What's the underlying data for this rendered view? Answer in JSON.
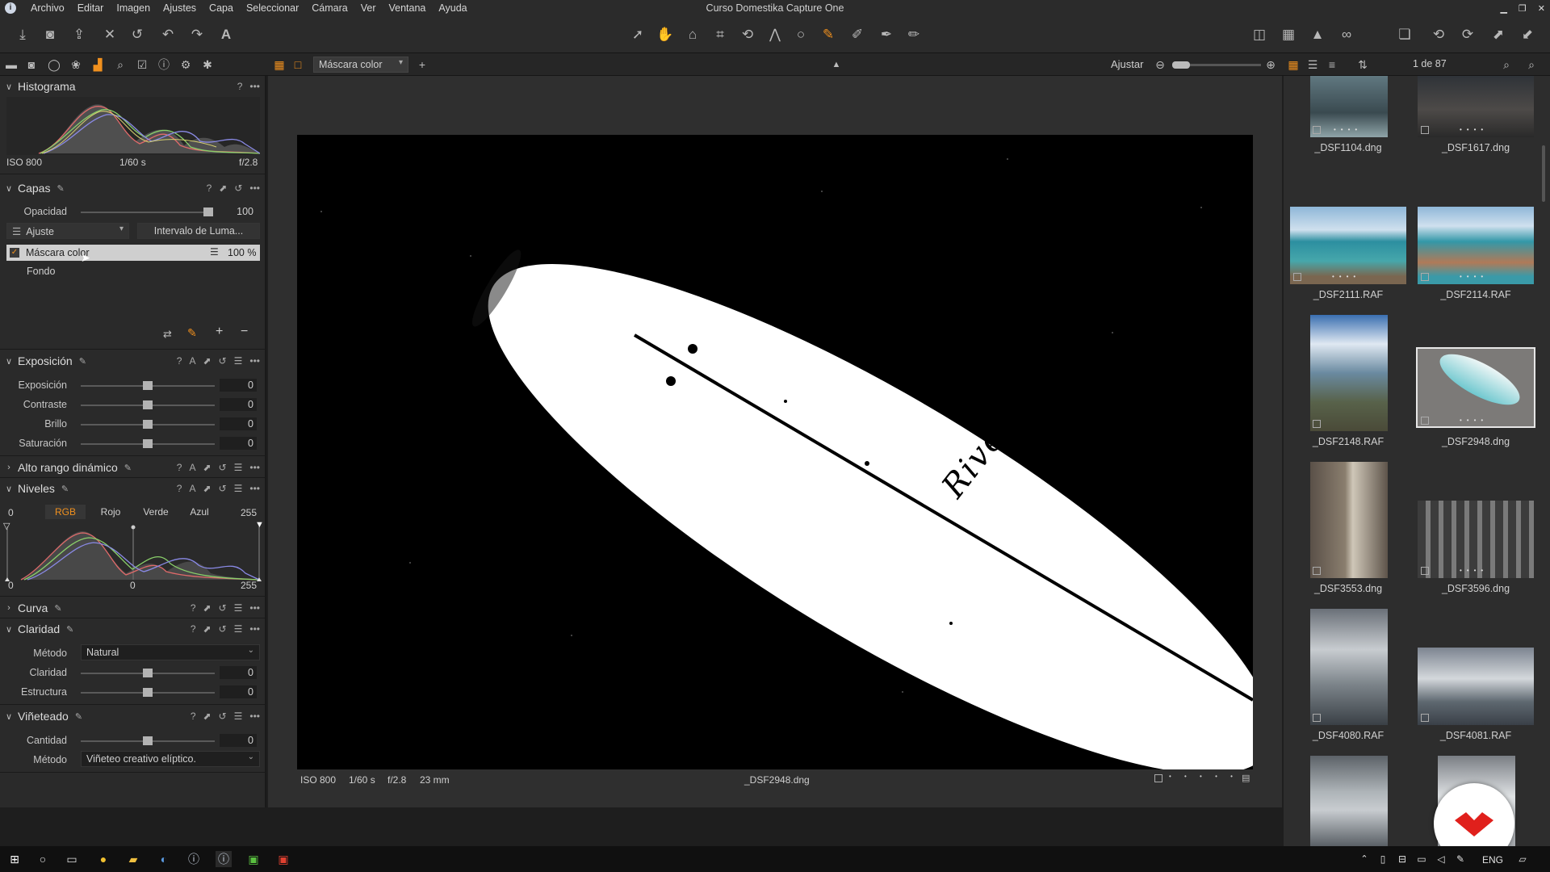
{
  "window": {
    "title": "Curso Domestika Capture One"
  },
  "menu": [
    "Archivo",
    "Editar",
    "Imagen",
    "Ajustes",
    "Capa",
    "Seleccionar",
    "Cámara",
    "Ver",
    "Ventana",
    "Ayuda"
  ],
  "viewer_toolbar": {
    "mode_dropdown": "Máscara color",
    "fit_label": "Ajustar"
  },
  "browser_header": {
    "counter": "1 de 87"
  },
  "histogram": {
    "title": "Histograma",
    "iso": "ISO 800",
    "shutter": "1/60 s",
    "aperture": "f/2.8"
  },
  "layers": {
    "title": "Capas",
    "opacity_label": "Opacidad",
    "opacity_value": "100",
    "adjust_dropdown": "Ajuste",
    "luma_button": "Intervalo de Luma...",
    "items": [
      {
        "name": "Máscara color",
        "opacity": "100 %",
        "checked": true
      },
      {
        "name": "Fondo"
      }
    ]
  },
  "exposure": {
    "title": "Exposición",
    "rows": [
      {
        "label": "Exposición",
        "value": "0"
      },
      {
        "label": "Contraste",
        "value": "0"
      },
      {
        "label": "Brillo",
        "value": "0"
      },
      {
        "label": "Saturación",
        "value": "0"
      }
    ]
  },
  "hdr": {
    "title": "Alto rango dinámico"
  },
  "levels": {
    "title": "Niveles",
    "in_low": "0",
    "in_high": "255",
    "channels": [
      "RGB",
      "Rojo",
      "Verde",
      "Azul"
    ],
    "out_low": "0",
    "out_mid": "0",
    "out_high": "255"
  },
  "curve": {
    "title": "Curva"
  },
  "clarity": {
    "title": "Claridad",
    "method_label": "Método",
    "method_value": "Natural",
    "rows": [
      {
        "label": "Claridad",
        "value": "0"
      },
      {
        "label": "Estructura",
        "value": "0"
      }
    ]
  },
  "vignetting": {
    "title": "Viñeteado",
    "amount_label": "Cantidad",
    "amount_value": "0",
    "method_label": "Método",
    "method_value": "Viñeteo creativo elíptico."
  },
  "image_meta": {
    "iso": "ISO 800",
    "shutter": "1/60 s",
    "aperture": "f/2.8",
    "focal": "23 mm",
    "filename": "_DSF2948.dng"
  },
  "photo": {
    "signature": "Rivera"
  },
  "thumbnails": [
    {
      "name": "_DSF1104.dng"
    },
    {
      "name": "_DSF1617.dng"
    },
    {
      "name": "_DSF2111.RAF"
    },
    {
      "name": "_DSF2114.RAF"
    },
    {
      "name": "_DSF2148.RAF"
    },
    {
      "name": "_DSF2948.dng",
      "selected": true
    },
    {
      "name": "_DSF3553.dng"
    },
    {
      "name": "_DSF3596.dng"
    },
    {
      "name": "_DSF4080.RAF"
    },
    {
      "name": "_DSF4081.RAF"
    },
    {
      "name": ""
    },
    {
      "name": ""
    }
  ],
  "taskbar": {
    "lang": "ENG"
  },
  "colors": {
    "accent": "#f0901e",
    "panel": "#2a2a2a",
    "viewer": "#2f2f2f",
    "brand_red": "#e0201c"
  }
}
